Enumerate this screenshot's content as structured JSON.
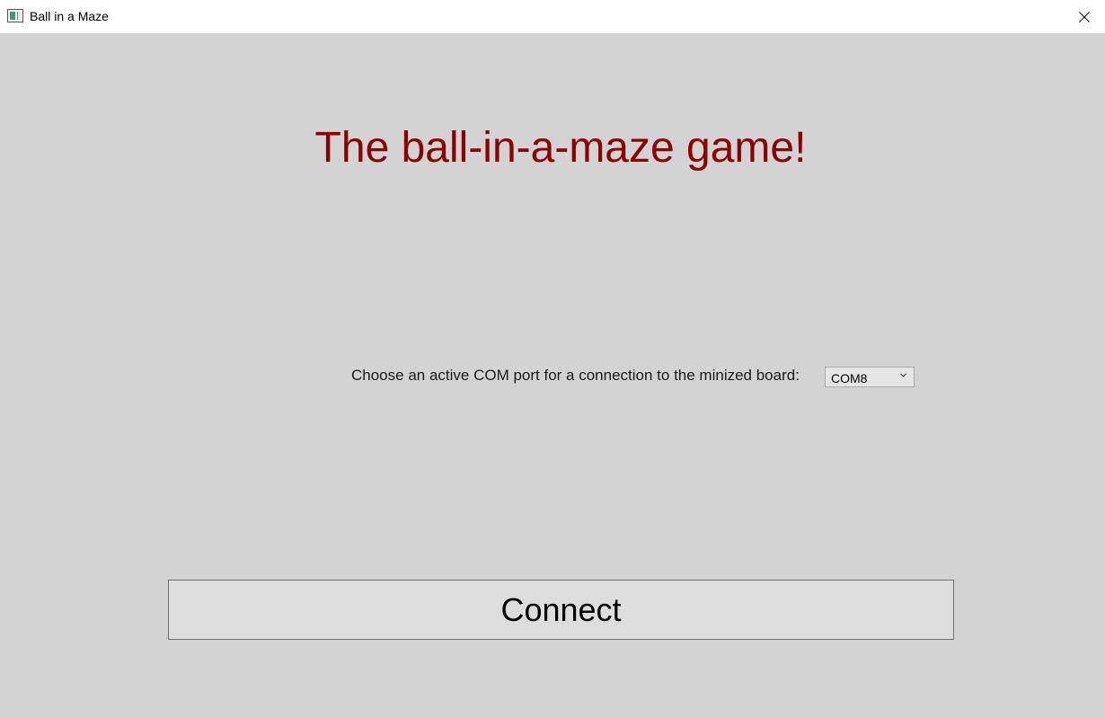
{
  "window": {
    "title": "Ball in a Maze",
    "app_icon": "window-app-icon",
    "close_icon": "close-icon"
  },
  "main": {
    "heading": "The ball-in-a-maze game!",
    "port_prompt": "Choose an active COM port for a connection to the minized board:",
    "port_select": {
      "selected": "COM8",
      "icon": "chevron-down-icon"
    },
    "connect_label": "Connect"
  },
  "colors": {
    "background": "#d3d3d3",
    "heading": "#8b0000",
    "button_bg": "#dddddd",
    "titlebar_bg": "#ffffff"
  }
}
